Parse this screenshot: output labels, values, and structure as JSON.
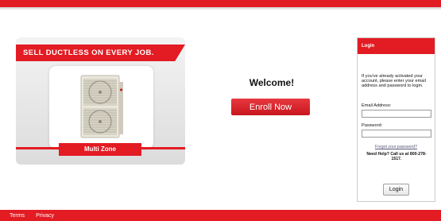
{
  "promo": {
    "headline": "SELL DUCTLESS ON EVERY JOB.",
    "product_label": "Multi Zone",
    "product_image_icon": "outdoor-condenser-unit",
    "accent": "#e31b23"
  },
  "main": {
    "welcome": "Welcome!",
    "enroll_label": "Enroll Now"
  },
  "login": {
    "title": "Login",
    "intro": "If you've already activated your account, please enter your email address and password to login.",
    "email_label": "Email Address:",
    "email_value": "",
    "password_label": "Password:",
    "password_value": "",
    "forgot_link": "Forgot your password?",
    "help_text": "Need Help? Call us at 800-278-1517.",
    "submit_label": "Login"
  },
  "footer": {
    "links": [
      "Terms",
      "Privacy"
    ]
  }
}
